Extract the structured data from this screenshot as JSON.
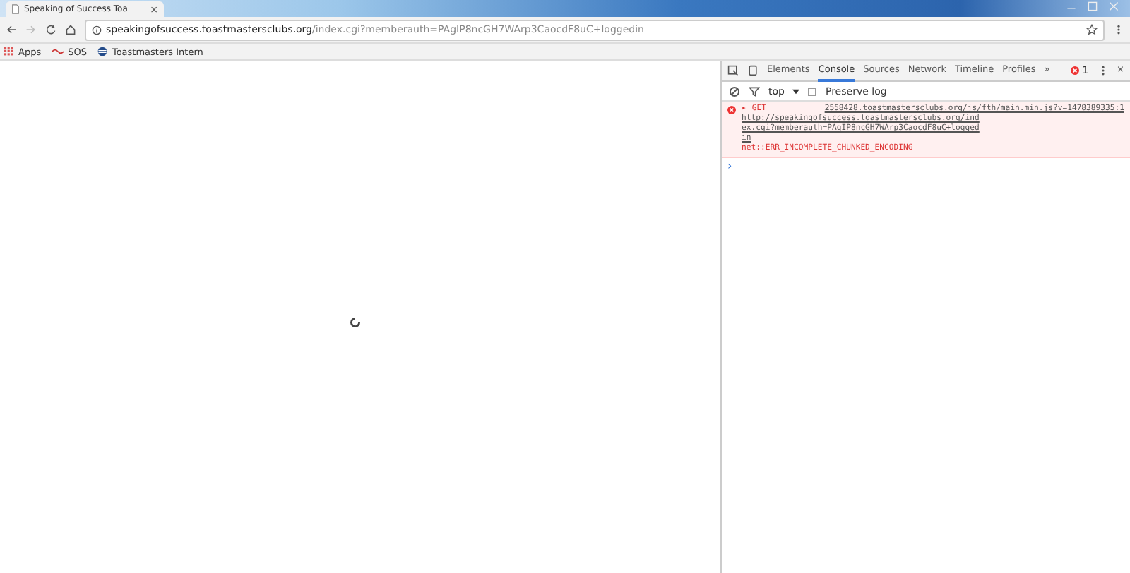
{
  "browser_tab": {
    "title": "Speaking of Success Toa",
    "close": "×"
  },
  "address_bar": {
    "host": "speakingofsuccess.toastmastersclubs.org",
    "path": "/index.cgi?memberauth=PAgIP8ncGH7WArp3CaocdF8uC+loggedin"
  },
  "bookmarks": [
    {
      "label": "Apps",
      "kind": "apps"
    },
    {
      "label": "SOS",
      "kind": "sos"
    },
    {
      "label": "Toastmasters Intern",
      "kind": "globe"
    }
  ],
  "devtools": {
    "tabs": [
      {
        "label": "Elements",
        "selected": false
      },
      {
        "label": "Console",
        "selected": true
      },
      {
        "label": "Sources",
        "selected": false
      },
      {
        "label": "Network",
        "selected": false
      },
      {
        "label": "Timeline",
        "selected": false
      },
      {
        "label": "Profiles",
        "selected": false
      }
    ],
    "more": "»",
    "error_count": "1",
    "close": "×",
    "context": "top",
    "preserve_log": {
      "label": "Preserve log",
      "checked": false
    },
    "messages": [
      {
        "expander": "▸",
        "method": "GET",
        "source": "2558428.toastmastersclubs.org/js/fth/main.min.js?v=1478389335:1",
        "url": "http://speakingofsuccess.toastmastersclubs.org/index.cgi?memberauth=PAgIP8ncGH7WArp3CaocdF8uC+loggedin",
        "error": "net::ERR_INCOMPLETE_CHUNKED_ENCODING"
      }
    ],
    "prompt": "›"
  }
}
